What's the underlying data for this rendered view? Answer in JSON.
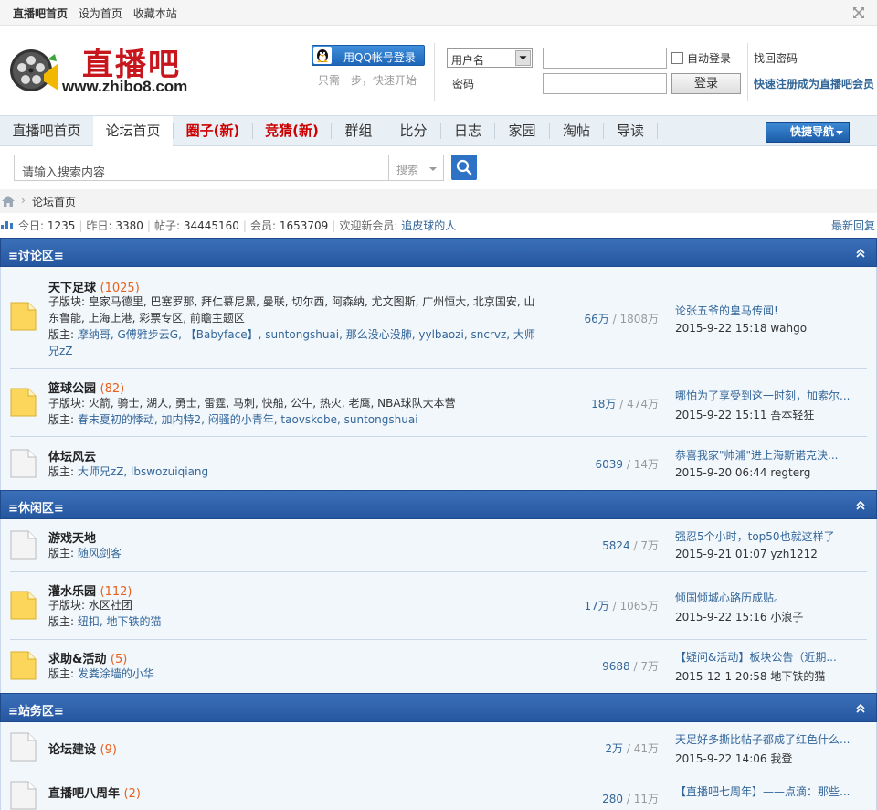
{
  "topbar": {
    "home": "直播吧首页",
    "set_home": "设为首页",
    "bookmark": "收藏本站"
  },
  "logo": {
    "name": "直播吧",
    "url": "www.zhibo8.com"
  },
  "login": {
    "qq_button": "用QQ帐号登录",
    "qq_hint": "只需一步，快速开始",
    "user_select": "用户名",
    "password_label": "密码",
    "auto_login": "自动登录",
    "login_button": "登录",
    "find_password": "找回密码",
    "register": "快速注册成为直播吧会员"
  },
  "nav": {
    "items": [
      "直播吧首页",
      "论坛首页",
      "圈子(新)",
      "竞猜(新)",
      "群组",
      "比分",
      "日志",
      "家园",
      "淘帖",
      "导读"
    ],
    "quick_nav": "快捷导航"
  },
  "search": {
    "placeholder": "请输入搜索内容",
    "type": "搜索"
  },
  "breadcrumb": {
    "current": "论坛首页"
  },
  "stats": {
    "today_label": "今日:",
    "today": "1235",
    "yesterday_label": "昨日:",
    "yesterday": "3380",
    "posts_label": "帖子:",
    "posts": "34445160",
    "members_label": "会员:",
    "members": "1653709",
    "welcome_label": "欢迎新会员:",
    "new_member": "追皮球的人",
    "latest_reply": "最新回复"
  },
  "categories": [
    {
      "title": "≡讨论区≡",
      "forums": [
        {
          "name": "天下足球",
          "count": "(1025)",
          "sub_label": "子版块:",
          "sub": "皇家马德里, 巴塞罗那, 拜仁慕尼黑, 曼联, 切尔西, 阿森纳, 尤文图斯, 广州恒大, 北京国安, 山东鲁能, 上海上港, 彩票专区, 前瞻主题区",
          "mod_label": "版主:",
          "mods": "摩纳哥, G傅雅步云G, 【Babyface】, suntongshuai, 那么没心没肺, yylbaozi, sncrvz, 大师兄zZ",
          "threads": "66万",
          "posts": "1808万",
          "last_title": "论张五爷的皇马传闻!",
          "last_meta": "2015-9-22 15:18 wahgo",
          "new": true
        },
        {
          "name": "篮球公园",
          "count": "(82)",
          "sub_label": "子版块:",
          "sub": "火箭, 骑士, 湖人, 勇士, 雷霆, 马刺, 快船, 公牛, 热火, 老鹰, NBA球队大本营",
          "mod_label": "版主:",
          "mods": "春末夏初的悸动, 加内特2, 闷骚的小青年, taovskobe, suntongshuai",
          "threads": "18万",
          "posts": "474万",
          "last_title": "哪怕为了享受到这一时刻，加索尔...",
          "last_meta": "2015-9-22 15:11 吾本轻狂",
          "new": true
        },
        {
          "name": "体坛风云",
          "count": "",
          "sub_label": "",
          "sub": "",
          "mod_label": "版主:",
          "mods": "大师兄zZ, lbswozuiqiang",
          "threads": "6039",
          "posts": "14万",
          "last_title": "恭喜我家\"帅浦\"进上海斯诺克決...",
          "last_meta": "2015-9-20 06:44 regterg",
          "new": false
        }
      ]
    },
    {
      "title": "≡休闲区≡",
      "forums": [
        {
          "name": "游戏天地",
          "count": "",
          "sub_label": "",
          "sub": "",
          "mod_label": "版主:",
          "mods": "随风剑客",
          "threads": "5824",
          "posts": "7万",
          "last_title": "强忍5个小时，top50也就这样了",
          "last_meta": "2015-9-21 01:07 yzh1212",
          "new": false
        },
        {
          "name": "灌水乐园",
          "count": "(112)",
          "sub_label": "子版块:",
          "sub": "水区社团",
          "mod_label": "版主:",
          "mods": "纽扣, 地下铁的猫",
          "threads": "17万",
          "posts": "1065万",
          "last_title": "倾国倾城心路历成贴。",
          "last_meta": "2015-9-22 15:16 小浪子",
          "new": true
        },
        {
          "name": "求助&活动",
          "count": "(5)",
          "sub_label": "",
          "sub": "",
          "mod_label": "版主:",
          "mods": "发粪涂墙的小华",
          "threads": "9688",
          "posts": "7万",
          "last_title": "【疑问&活动】板块公告（近期...",
          "last_meta": "2015-12-1 20:58 地下铁的猫",
          "new": true
        }
      ]
    },
    {
      "title": "≡站务区≡",
      "forums": [
        {
          "name": "论坛建设",
          "count": "(9)",
          "sub_label": "",
          "sub": "",
          "mod_label": "",
          "mods": "",
          "threads": "2万",
          "posts": "41万",
          "last_title": "天足好多撕比帖子都成了红色什么...",
          "last_meta": "2015-9-22 14:06 我登",
          "new": false
        },
        {
          "name": "直播吧八周年",
          "count": "(2)",
          "sub_label": "",
          "sub": "",
          "mod_label": "",
          "mods": "",
          "threads": "280",
          "posts": "11万",
          "last_title": "【直播吧七周年】——点滴：那些...",
          "last_meta": "",
          "new": false
        }
      ]
    }
  ]
}
